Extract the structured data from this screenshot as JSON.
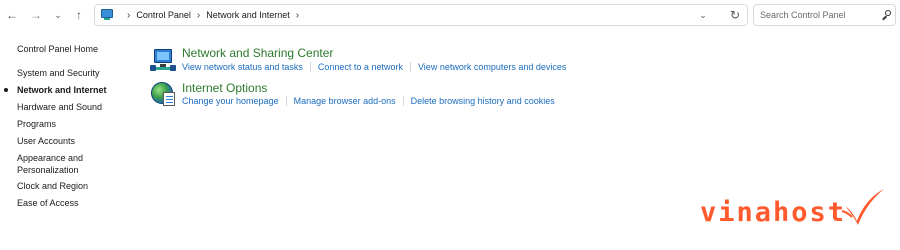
{
  "nav": {
    "back_glyph": "←",
    "forward_glyph": "→",
    "recent_glyph": "⌄",
    "up_glyph": "↑"
  },
  "address_bar": {
    "icon": "control-panel-icon",
    "breadcrumbs": [
      "Control Panel",
      "Network and Internet"
    ],
    "separator_glyph": "›",
    "dropdown_glyph": "⌄",
    "refresh_glyph": "↻"
  },
  "search": {
    "placeholder": "Search Control Panel",
    "value": "",
    "icon": "search-icon"
  },
  "sidebar": {
    "items": [
      {
        "label": "Control Panel Home",
        "active": false
      },
      {
        "label": "System and Security",
        "active": false
      },
      {
        "label": "Network and Internet",
        "active": true
      },
      {
        "label": "Hardware and Sound",
        "active": false
      },
      {
        "label": "Programs",
        "active": false
      },
      {
        "label": "User Accounts",
        "active": false
      },
      {
        "label": "Appearance and Personalization",
        "active": false
      },
      {
        "label": "Clock and Region",
        "active": false
      },
      {
        "label": "Ease of Access",
        "active": false
      }
    ]
  },
  "categories": [
    {
      "title": "Network and Sharing Center",
      "icon": "network-sharing-icon",
      "tasks": [
        "View network status and tasks",
        "Connect to a network",
        "View network computers and devices"
      ]
    },
    {
      "title": "Internet Options",
      "icon": "internet-options-icon",
      "tasks": [
        "Change your homepage",
        "Manage browser add-ons",
        "Delete browsing history and cookies"
      ]
    }
  ],
  "watermark": {
    "text": "vinahost",
    "mark": "checkmark-logo",
    "color": "#ff5a2e"
  },
  "colors": {
    "category_title": "#2c7a2c",
    "task_link": "#1b6cbf",
    "text": "#1a1a1a"
  }
}
